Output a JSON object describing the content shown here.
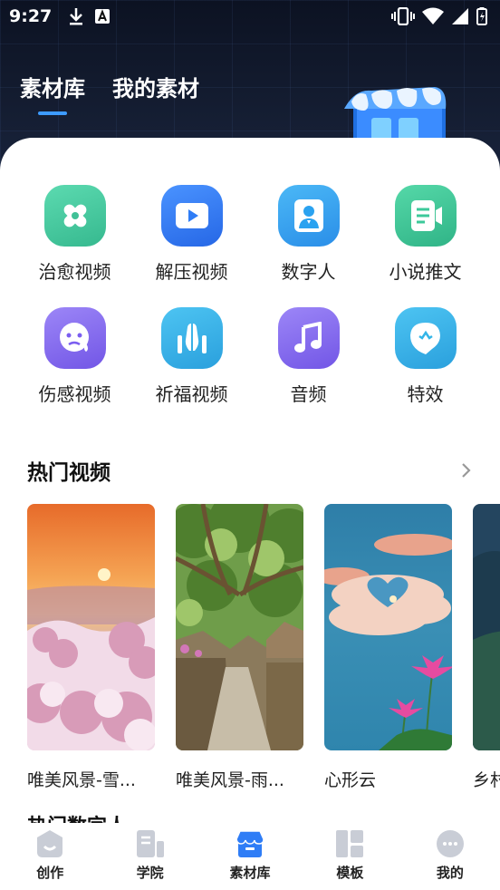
{
  "status_bar": {
    "time": "9:27",
    "left_icons": [
      "download-icon",
      "font-a-icon"
    ],
    "right_icons": [
      "vibrate-icon",
      "wifi-icon",
      "signal-icon",
      "battery-icon"
    ]
  },
  "top_tabs": [
    {
      "label": "素材库",
      "active": true
    },
    {
      "label": "我的素材",
      "active": false
    }
  ],
  "categories": [
    {
      "label": "治愈视频",
      "icon": "bandage-icon",
      "color": "#46c9a0"
    },
    {
      "label": "解压视频",
      "icon": "play-icon",
      "color": "#2f7df6"
    },
    {
      "label": "数字人",
      "icon": "person-icon",
      "color": "#2aa2f0"
    },
    {
      "label": "小说推文",
      "icon": "document-icon",
      "color": "#3cc99a"
    },
    {
      "label": "伤感视频",
      "icon": "sad-face-icon",
      "color": "#8a6ff0"
    },
    {
      "label": "祈福视频",
      "icon": "praying-hands-icon",
      "color": "#33b5e8"
    },
    {
      "label": "音频",
      "icon": "music-note-icon",
      "color": "#8a6ff0"
    },
    {
      "label": "特效",
      "icon": "sparkle-tag-icon",
      "color": "#33b5e8"
    }
  ],
  "hot_videos": {
    "title": "热门视频",
    "more_icon": "chevron-right-icon",
    "items": [
      {
        "title": "唯美风景-雪..."
      },
      {
        "title": "唯美风景-雨..."
      },
      {
        "title": "心形云"
      },
      {
        "title": "乡村"
      }
    ]
  },
  "section2_title": "热门数字人",
  "bottom_nav": [
    {
      "label": "创作",
      "icon": "create-icon",
      "active": false
    },
    {
      "label": "学院",
      "icon": "academy-icon",
      "active": false
    },
    {
      "label": "素材库",
      "icon": "shop-icon",
      "active": true
    },
    {
      "label": "模板",
      "icon": "template-icon",
      "active": false
    },
    {
      "label": "我的",
      "icon": "profile-icon",
      "active": false
    }
  ],
  "colors": {
    "accent": "#3d9bff",
    "nav_active": "#2f7df6",
    "nav_inactive": "#c9cdd6"
  }
}
